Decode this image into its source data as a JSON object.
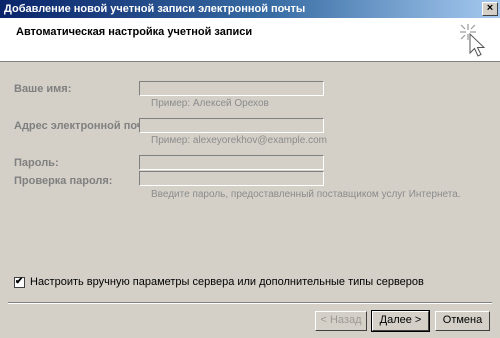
{
  "window": {
    "title": "Добавление новой учетной записи электронной почты",
    "close_glyph": "×"
  },
  "header": {
    "title": "Автоматическая настройка учетной записи",
    "icon": "cursor-sparkle-icon"
  },
  "form": {
    "name_label": "Ваше имя:",
    "name_value": "",
    "name_hint": "Пример: Алексей Орехов",
    "email_label": "Адрес электронной почты:",
    "email_value": "",
    "email_hint": "Пример: alexeyorekhov@example.com",
    "password_label": "Пароль:",
    "password_value": "",
    "password_confirm_label": "Проверка пароля:",
    "password_confirm_value": "",
    "password_hint": "Введите пароль, предоставленный поставщиком услуг Интернета."
  },
  "manual_setup": {
    "checked": true,
    "check_glyph": "✔",
    "label": "Настроить вручную параметры сервера или дополнительные типы серверов"
  },
  "buttons": {
    "back": "< Назад",
    "next": "Далее >",
    "cancel": "Отмена"
  },
  "colors": {
    "dialog_bg": "#d4d0c8",
    "title_start": "#0a246a",
    "title_end": "#a6caf0",
    "disabled_text": "#808080"
  }
}
